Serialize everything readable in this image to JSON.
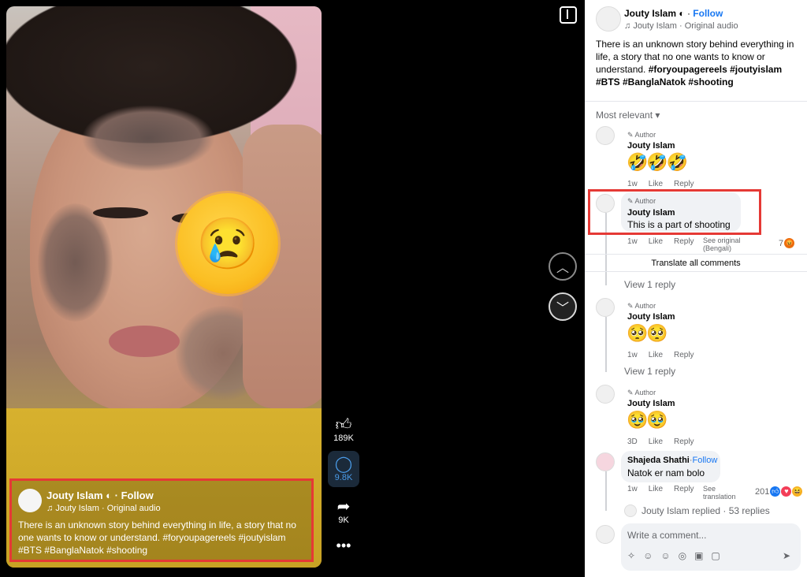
{
  "video": {
    "channel_name": "Jouty Islam",
    "follow": "Follow",
    "audio": "Jouty Islam · Original audio",
    "caption": "There is an unknown story behind everything in life, a story that no one wants to know or understand.  #foryoupagereels #joutyislam #BTS  #BanglaNatok  #shooting",
    "emoji": "😢"
  },
  "actions": {
    "likes": "189K",
    "comments": "9.8K",
    "shares": "9K"
  },
  "panel": {
    "author_name": "Jouty Islam",
    "follow": "Follow",
    "audio": "Jouty Islam · Original audio",
    "description": "There is an unknown story behind everything in life, a story that no one wants to know or understand.",
    "hashtags_line1": "#foryoupagereels #joutyislam",
    "hashtags_line2": "#BTS  #BanglaNatok  #shooting",
    "sort_label": "Most relevant"
  },
  "comments": [
    {
      "author_tag": "Author",
      "name": "Jouty Islam",
      "emoji": "🤣🤣🤣",
      "time": "1w",
      "like": "Like",
      "reply": "Reply"
    },
    {
      "author_tag": "Author",
      "name": "Jouty Islam",
      "text": "This is a part of shooting",
      "time": "1w",
      "like": "Like",
      "reply": "Reply",
      "see_original": "See original",
      "see_original_lang": "(Bengali)",
      "reaction_count": "7"
    },
    {
      "author_tag": "Author",
      "name": "Jouty Islam",
      "emoji": "🥺🥺",
      "time": "1w",
      "like": "Like",
      "reply": "Reply"
    },
    {
      "author_tag": "Author",
      "name": "Jouty Islam",
      "emoji": "🥹🥹",
      "time": "3D",
      "like": "Like",
      "reply": "Reply"
    },
    {
      "name": "Shajeda Shathi",
      "follow": "Follow",
      "text": "Natok er nam bolo",
      "time": "1w",
      "like": "Like",
      "reply": "Reply",
      "see_translation": "See",
      "see_translation2": "translation",
      "reaction_count": "201"
    }
  ],
  "translate_all": "Translate all comments",
  "view_reply": "View 1 reply",
  "replied_summary": "Jouty Islam replied · 53 replies",
  "composer_placeholder": "Write a comment..."
}
